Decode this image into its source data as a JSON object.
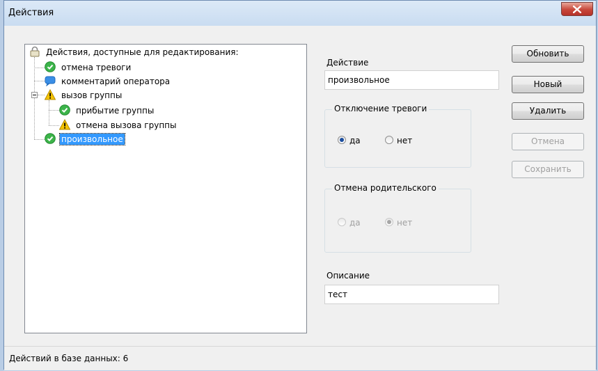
{
  "window": {
    "title": "Действия"
  },
  "tree": {
    "root": "Действия, доступные для редактирования:",
    "items": [
      {
        "label": "отмена тревоги",
        "icon": "green-check-icon"
      },
      {
        "label": "комментарий оператора",
        "icon": "speech-bubble-icon"
      },
      {
        "label": "вызов группы",
        "icon": "warning-icon",
        "children": [
          {
            "label": "прибытие группы",
            "icon": "green-check-icon"
          },
          {
            "label": "отмена вызова группы",
            "icon": "warning-icon"
          }
        ]
      },
      {
        "label": "произвольное",
        "icon": "green-check-icon",
        "selected": true
      }
    ]
  },
  "form": {
    "action_label": "Действие",
    "action_value": "произвольное",
    "alarm_group": {
      "title": "Отключение тревоги",
      "yes": "да",
      "no": "нет",
      "selected": "да",
      "enabled": true
    },
    "parent_group": {
      "title": "Отмена родительского",
      "yes": "да",
      "no": "нет",
      "selected": "нет",
      "enabled": false
    },
    "description_label": "Описание",
    "description_value": "тест"
  },
  "buttons": {
    "refresh": "Обновить",
    "new": "Новый",
    "delete": "Удалить",
    "cancel": "Отмена",
    "save": "Сохранить"
  },
  "status": {
    "text": "Действий в базе данных: 6"
  },
  "colors": {
    "selection": "#3399ff",
    "check": "#3cb44a",
    "warning": "#f5c400",
    "bubble": "#3a8ee6"
  }
}
